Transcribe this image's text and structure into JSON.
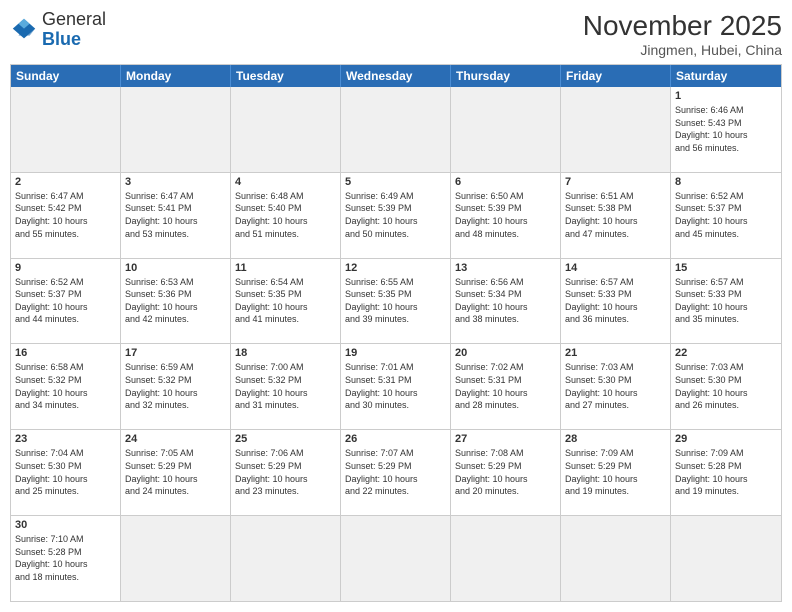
{
  "logo": {
    "general": "General",
    "blue": "Blue"
  },
  "title": "November 2025",
  "location": "Jingmen, Hubei, China",
  "days": [
    "Sunday",
    "Monday",
    "Tuesday",
    "Wednesday",
    "Thursday",
    "Friday",
    "Saturday"
  ],
  "rows": [
    [
      {
        "day": "",
        "info": ""
      },
      {
        "day": "",
        "info": ""
      },
      {
        "day": "",
        "info": ""
      },
      {
        "day": "",
        "info": ""
      },
      {
        "day": "",
        "info": ""
      },
      {
        "day": "",
        "info": ""
      },
      {
        "day": "1",
        "info": "Sunrise: 6:46 AM\nSunset: 5:43 PM\nDaylight: 10 hours\nand 56 minutes."
      }
    ],
    [
      {
        "day": "2",
        "info": "Sunrise: 6:47 AM\nSunset: 5:42 PM\nDaylight: 10 hours\nand 55 minutes."
      },
      {
        "day": "3",
        "info": "Sunrise: 6:47 AM\nSunset: 5:41 PM\nDaylight: 10 hours\nand 53 minutes."
      },
      {
        "day": "4",
        "info": "Sunrise: 6:48 AM\nSunset: 5:40 PM\nDaylight: 10 hours\nand 51 minutes."
      },
      {
        "day": "5",
        "info": "Sunrise: 6:49 AM\nSunset: 5:39 PM\nDaylight: 10 hours\nand 50 minutes."
      },
      {
        "day": "6",
        "info": "Sunrise: 6:50 AM\nSunset: 5:39 PM\nDaylight: 10 hours\nand 48 minutes."
      },
      {
        "day": "7",
        "info": "Sunrise: 6:51 AM\nSunset: 5:38 PM\nDaylight: 10 hours\nand 47 minutes."
      },
      {
        "day": "8",
        "info": "Sunrise: 6:52 AM\nSunset: 5:37 PM\nDaylight: 10 hours\nand 45 minutes."
      }
    ],
    [
      {
        "day": "9",
        "info": "Sunrise: 6:52 AM\nSunset: 5:37 PM\nDaylight: 10 hours\nand 44 minutes."
      },
      {
        "day": "10",
        "info": "Sunrise: 6:53 AM\nSunset: 5:36 PM\nDaylight: 10 hours\nand 42 minutes."
      },
      {
        "day": "11",
        "info": "Sunrise: 6:54 AM\nSunset: 5:35 PM\nDaylight: 10 hours\nand 41 minutes."
      },
      {
        "day": "12",
        "info": "Sunrise: 6:55 AM\nSunset: 5:35 PM\nDaylight: 10 hours\nand 39 minutes."
      },
      {
        "day": "13",
        "info": "Sunrise: 6:56 AM\nSunset: 5:34 PM\nDaylight: 10 hours\nand 38 minutes."
      },
      {
        "day": "14",
        "info": "Sunrise: 6:57 AM\nSunset: 5:33 PM\nDaylight: 10 hours\nand 36 minutes."
      },
      {
        "day": "15",
        "info": "Sunrise: 6:57 AM\nSunset: 5:33 PM\nDaylight: 10 hours\nand 35 minutes."
      }
    ],
    [
      {
        "day": "16",
        "info": "Sunrise: 6:58 AM\nSunset: 5:32 PM\nDaylight: 10 hours\nand 34 minutes."
      },
      {
        "day": "17",
        "info": "Sunrise: 6:59 AM\nSunset: 5:32 PM\nDaylight: 10 hours\nand 32 minutes."
      },
      {
        "day": "18",
        "info": "Sunrise: 7:00 AM\nSunset: 5:32 PM\nDaylight: 10 hours\nand 31 minutes."
      },
      {
        "day": "19",
        "info": "Sunrise: 7:01 AM\nSunset: 5:31 PM\nDaylight: 10 hours\nand 30 minutes."
      },
      {
        "day": "20",
        "info": "Sunrise: 7:02 AM\nSunset: 5:31 PM\nDaylight: 10 hours\nand 28 minutes."
      },
      {
        "day": "21",
        "info": "Sunrise: 7:03 AM\nSunset: 5:30 PM\nDaylight: 10 hours\nand 27 minutes."
      },
      {
        "day": "22",
        "info": "Sunrise: 7:03 AM\nSunset: 5:30 PM\nDaylight: 10 hours\nand 26 minutes."
      }
    ],
    [
      {
        "day": "23",
        "info": "Sunrise: 7:04 AM\nSunset: 5:30 PM\nDaylight: 10 hours\nand 25 minutes."
      },
      {
        "day": "24",
        "info": "Sunrise: 7:05 AM\nSunset: 5:29 PM\nDaylight: 10 hours\nand 24 minutes."
      },
      {
        "day": "25",
        "info": "Sunrise: 7:06 AM\nSunset: 5:29 PM\nDaylight: 10 hours\nand 23 minutes."
      },
      {
        "day": "26",
        "info": "Sunrise: 7:07 AM\nSunset: 5:29 PM\nDaylight: 10 hours\nand 22 minutes."
      },
      {
        "day": "27",
        "info": "Sunrise: 7:08 AM\nSunset: 5:29 PM\nDaylight: 10 hours\nand 20 minutes."
      },
      {
        "day": "28",
        "info": "Sunrise: 7:09 AM\nSunset: 5:29 PM\nDaylight: 10 hours\nand 19 minutes."
      },
      {
        "day": "29",
        "info": "Sunrise: 7:09 AM\nSunset: 5:28 PM\nDaylight: 10 hours\nand 19 minutes."
      }
    ],
    [
      {
        "day": "30",
        "info": "Sunrise: 7:10 AM\nSunset: 5:28 PM\nDaylight: 10 hours\nand 18 minutes."
      },
      {
        "day": "",
        "info": ""
      },
      {
        "day": "",
        "info": ""
      },
      {
        "day": "",
        "info": ""
      },
      {
        "day": "",
        "info": ""
      },
      {
        "day": "",
        "info": ""
      },
      {
        "day": "",
        "info": ""
      }
    ]
  ]
}
